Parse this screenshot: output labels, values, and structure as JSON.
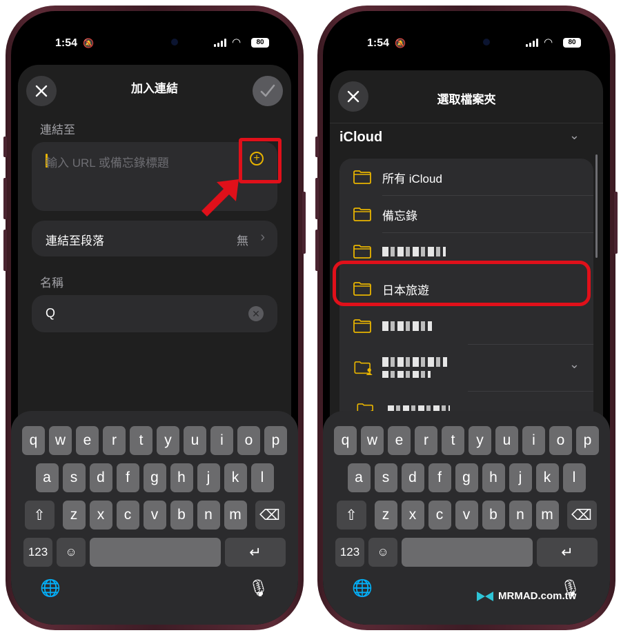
{
  "status": {
    "time": "1:54",
    "battery": "80"
  },
  "left": {
    "title": "加入連結",
    "link_to_label": "連結至",
    "url_placeholder": "輸入 URL 或備忘錄標題",
    "link_paragraph_label": "連結至段落",
    "link_paragraph_value": "無",
    "name_label": "名稱",
    "name_value": "Q"
  },
  "right": {
    "title": "選取檔案夾",
    "group_title": "iCloud",
    "folders": [
      {
        "name": "所有 iCloud"
      },
      {
        "name": "備忘錄"
      },
      {
        "name": ""
      },
      {
        "name": "日本旅遊"
      },
      {
        "name": ""
      },
      {
        "name": ""
      },
      {
        "name": ""
      }
    ]
  },
  "keyboard": {
    "row1": [
      "q",
      "w",
      "e",
      "r",
      "t",
      "y",
      "u",
      "i",
      "o",
      "p"
    ],
    "row2": [
      "a",
      "s",
      "d",
      "f",
      "g",
      "h",
      "j",
      "k",
      "l"
    ],
    "row3": [
      "z",
      "x",
      "c",
      "v",
      "b",
      "n",
      "m"
    ],
    "num_key": "123"
  },
  "watermark": "MRMAD.com.tw",
  "colors": {
    "accent": "#e8b400",
    "highlight": "#e0101a",
    "sheet": "#1f1f1f"
  }
}
